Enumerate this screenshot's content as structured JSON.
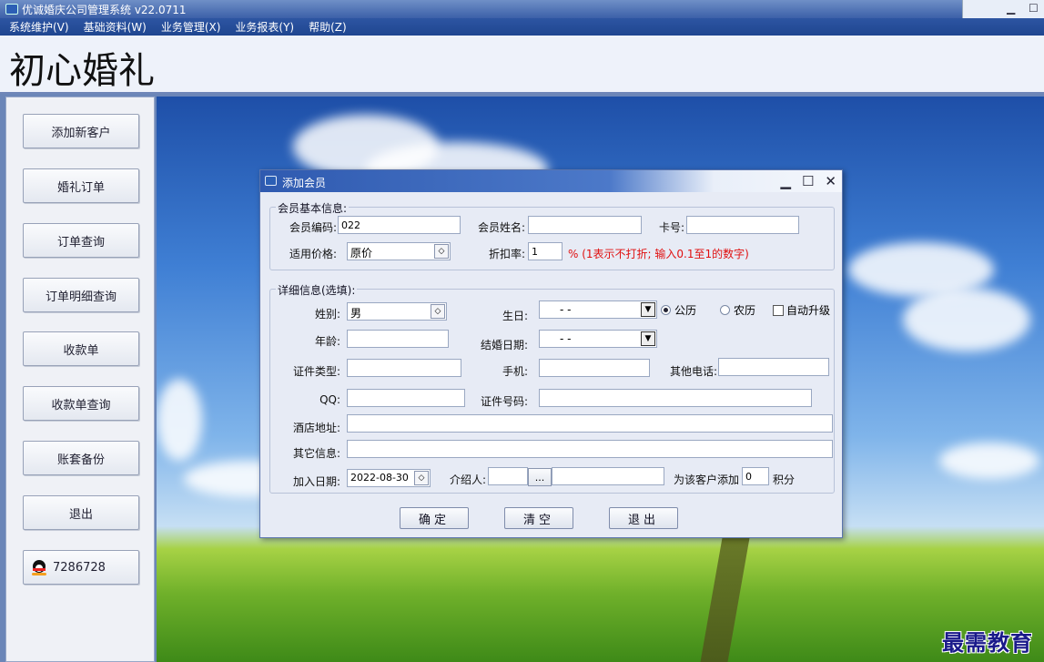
{
  "window": {
    "title": "优诚婚庆公司管理系统  v22.0711"
  },
  "menu": [
    {
      "label": "系统维护(V)"
    },
    {
      "label": "基础资料(W)"
    },
    {
      "label": "业务管理(X)"
    },
    {
      "label": "业务报表(Y)"
    },
    {
      "label": "帮助(Z)"
    }
  ],
  "banner": {
    "brand": "初心婚礼"
  },
  "sidebar": {
    "buttons": [
      {
        "label": "添加新客户"
      },
      {
        "label": "婚礼订单"
      },
      {
        "label": "订单查询"
      },
      {
        "label": "订单明细查询"
      },
      {
        "label": "收款单"
      },
      {
        "label": "收款单查询"
      },
      {
        "label": "账套备份"
      },
      {
        "label": "退出"
      }
    ],
    "qq_number": "7286728"
  },
  "dialog": {
    "title": "添加会员",
    "basic_group": "会员基本信息:",
    "member_code_label": "会员编码:",
    "member_code_value": "022",
    "member_name_label": "会员姓名:",
    "card_label": "卡号:",
    "price_label": "适用价格:",
    "price_value": "原价",
    "discount_label": "折扣率:",
    "discount_value": "1",
    "discount_hint": "% (1表示不打折; 输入0.1至1的数字)",
    "detail_group": "详细信息(选填):",
    "gender_label": "姓别:",
    "gender_value": "男",
    "birthday_label": "生日:",
    "birthday_value": "-  -",
    "solar_label": "公历",
    "lunar_label": "农历",
    "auto_upgrade_label": "自动升级",
    "age_label": "年龄:",
    "wedding_date_label": "结婚日期:",
    "wedding_date_value": "-  -",
    "id_type_label": "证件类型:",
    "mobile_label": "手机:",
    "other_phone_label": "其他电话:",
    "qq_label": "QQ:",
    "id_number_label": "证件号码:",
    "hotel_label": "酒店地址:",
    "other_info_label": "其它信息:",
    "join_date_label": "加入日期:",
    "join_date_value": "2022-08-30",
    "referrer_label": "介绍人:",
    "browse_label": "...",
    "points_label": "为该客户添加",
    "points_value": "0",
    "points_unit": "积分",
    "ok_label": "确定",
    "clear_label": "清空",
    "exit_label": "退出"
  },
  "watermark": "最需教育"
}
